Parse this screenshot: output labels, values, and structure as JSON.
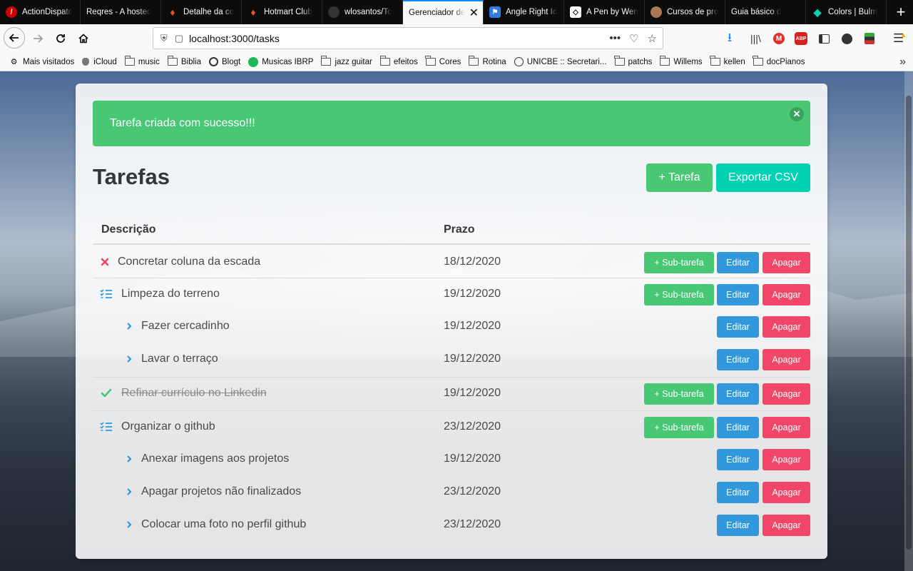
{
  "browser": {
    "tabs": [
      {
        "label": "ActionDispatc",
        "icon": "rails-icon",
        "color": "#cc0000"
      },
      {
        "label": "Reqres - A hosted",
        "icon": "",
        "color": ""
      },
      {
        "label": "Detalhe da co",
        "icon": "hotmart-flame-icon",
        "color": "#f04e23"
      },
      {
        "label": "Hotmart Club",
        "icon": "hotmart-flame-icon",
        "color": "#f04e23"
      },
      {
        "label": "wlosantos/To",
        "icon": "github-icon",
        "color": "#333333"
      },
      {
        "label": "Gerenciador de",
        "icon": "",
        "color": "",
        "active": true
      },
      {
        "label": "Angle Right Ic",
        "icon": "flag-icon",
        "color": "#2f7de1"
      },
      {
        "label": "A Pen by Wen",
        "icon": "codepen-icon",
        "color": "#ffffff"
      },
      {
        "label": "Cursos de pro",
        "icon": "person-icon",
        "color": "#aa7755"
      },
      {
        "label": "Guia básico d",
        "icon": "",
        "color": ""
      },
      {
        "label": "Colors | Bulm",
        "icon": "bulma-icon",
        "color": "#00d1b2"
      }
    ],
    "url": "localhost:3000/tasks",
    "bookmarks": [
      {
        "label": "Mais visitados",
        "icon": "gear-icon"
      },
      {
        "label": "iCloud",
        "icon": "apple-icon"
      },
      {
        "label": "music",
        "icon": "folder-icon"
      },
      {
        "label": "Biblia",
        "icon": "folder-icon"
      },
      {
        "label": "Blogt",
        "icon": "github-icon"
      },
      {
        "label": "Musicas IBRP",
        "icon": "spotify-icon"
      },
      {
        "label": "jazz guitar",
        "icon": "folder-icon"
      },
      {
        "label": "efeitos",
        "icon": "folder-icon"
      },
      {
        "label": "Cores",
        "icon": "folder-icon"
      },
      {
        "label": "Rotina",
        "icon": "folder-icon"
      },
      {
        "label": "UNICBE :: Secretari...",
        "icon": "globe-icon"
      },
      {
        "label": "patchs",
        "icon": "folder-icon"
      },
      {
        "label": "Willems",
        "icon": "folder-icon"
      },
      {
        "label": "kellen",
        "icon": "folder-icon"
      },
      {
        "label": "docPianos",
        "icon": "folder-icon"
      }
    ]
  },
  "notification": {
    "text": "Tarefa criada com sucesso!!!",
    "color": "#48c774"
  },
  "page": {
    "title": "Tarefas",
    "new_task_button": "+ Tarefa",
    "export_button": "Exportar CSV"
  },
  "table": {
    "headers": {
      "description": "Descrição",
      "deadline": "Prazo"
    },
    "rows": [
      {
        "text": "Concretar coluna da escada",
        "date": "18/12/2020",
        "icon": "x-mark-icon",
        "level": "task",
        "sub": "+ Sub-tarefa",
        "edit": "Editar",
        "delete": "Apagar"
      },
      {
        "text": "Limpeza do terreno",
        "date": "19/12/2020",
        "icon": "tasks-list-icon",
        "level": "task",
        "sub": "+ Sub-tarefa",
        "edit": "Editar",
        "delete": "Apagar"
      },
      {
        "text": "Fazer cercadinho",
        "date": "19/12/2020",
        "icon": "angle-right-icon",
        "level": "subtask",
        "edit": "Editar",
        "delete": "Apagar"
      },
      {
        "text": "Lavar o terraço",
        "date": "19/12/2020",
        "icon": "angle-right-icon",
        "level": "subtask",
        "edit": "Editar",
        "delete": "Apagar"
      },
      {
        "text": "Refinar currículo no Linkedin",
        "date": "19/12/2020",
        "icon": "check-icon",
        "level": "task",
        "done": true,
        "sub": "+ Sub-tarefa",
        "edit": "Editar",
        "delete": "Apagar"
      },
      {
        "text": "Organizar o github",
        "date": "23/12/2020",
        "icon": "tasks-list-icon",
        "level": "task",
        "sub": "+ Sub-tarefa",
        "edit": "Editar",
        "delete": "Apagar"
      },
      {
        "text": "Anexar imagens aos projetos",
        "date": "19/12/2020",
        "icon": "angle-right-icon",
        "level": "subtask",
        "edit": "Editar",
        "delete": "Apagar"
      },
      {
        "text": "Apagar projetos não finalizados",
        "date": "23/12/2020",
        "icon": "angle-right-icon",
        "level": "subtask",
        "edit": "Editar",
        "delete": "Apagar"
      },
      {
        "text": "Colocar uma foto no perfil github",
        "date": "23/12/2020",
        "icon": "angle-right-icon",
        "level": "subtask",
        "edit": "Editar",
        "delete": "Apagar"
      }
    ]
  },
  "colors": {
    "success": "#48c774",
    "primary": "#00d1b2",
    "info": "#3298dc",
    "danger": "#f14668",
    "link": "#3298dc"
  }
}
